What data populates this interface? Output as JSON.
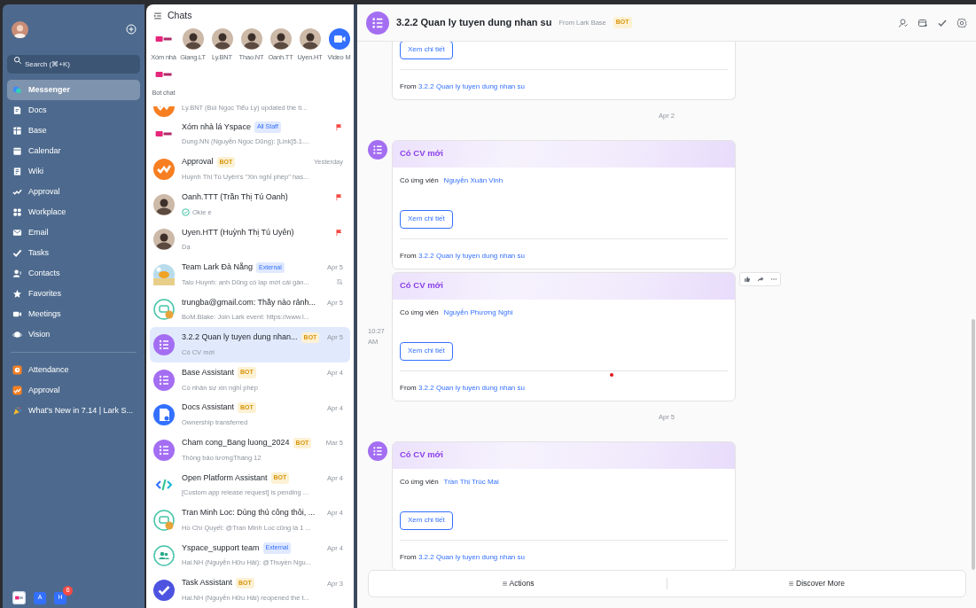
{
  "sidebar": {
    "search": {
      "placeholder": "Search (⌘+K)"
    },
    "items": [
      {
        "label": "Messenger",
        "selected": true
      },
      {
        "label": "Docs",
        "selected": false
      },
      {
        "label": "Base",
        "selected": false
      },
      {
        "label": "Calendar",
        "selected": false
      },
      {
        "label": "Wiki",
        "selected": false
      },
      {
        "label": "Approval",
        "selected": false
      },
      {
        "label": "Workplace",
        "selected": false
      },
      {
        "label": "Email",
        "selected": false
      },
      {
        "label": "Tasks",
        "selected": false
      },
      {
        "label": "Contacts",
        "selected": false
      },
      {
        "label": "Favorites",
        "selected": false
      },
      {
        "label": "Meetings",
        "selected": false
      },
      {
        "label": "Vision",
        "selected": false
      }
    ],
    "pinned": [
      {
        "label": "Attendance"
      },
      {
        "label": "Approval"
      },
      {
        "label": "What's New in 7.14 | Lark S..."
      }
    ],
    "dock": [
      {
        "kind": "logo"
      },
      {
        "kind": "letter",
        "label": "A"
      },
      {
        "kind": "letter",
        "label": "H",
        "badge": "6"
      }
    ]
  },
  "chats": {
    "title": "Chats",
    "pinned": [
      {
        "label": "Xóm nhà",
        "kind": "logo"
      },
      {
        "label": "Giang.LT",
        "kind": "person"
      },
      {
        "label": "Ly.BNT",
        "kind": "person"
      },
      {
        "label": "Thao.NT",
        "kind": "person"
      },
      {
        "label": "Oanh.TT",
        "kind": "person"
      },
      {
        "label": "Uyen.HT",
        "kind": "person"
      },
      {
        "label": "Video M",
        "kind": "video"
      },
      {
        "label": "Bot chat",
        "kind": "logo"
      }
    ],
    "items": [
      {
        "kind": "approval",
        "preview": "Ly.BNT (Bùi Ngọc Tiểu Ly) updated the ti...",
        "selected": false,
        "flagged": false,
        "muted": false,
        "read": false
      },
      {
        "kind": "logo",
        "name": "Xóm nhà lá Yspace",
        "tag": {
          "label": "All Staff",
          "kind": "team"
        },
        "preview": "Dung.NN (Nguyễn Ngọc Dũng): [Link]5.1....",
        "selected": false,
        "flagged": true,
        "muted": false,
        "read": false
      },
      {
        "kind": "approval",
        "name": "Approval",
        "tag": {
          "label": "BOT",
          "kind": "bot"
        },
        "date": "Yesterday",
        "preview": "Huỳnh Thị Tú Uyên's \"Xin nghỉ phép\" has...",
        "selected": false,
        "flagged": false,
        "muted": false,
        "read": false
      },
      {
        "kind": "person",
        "name": "Oanh.TTT (Trần Thị Tú Oanh)",
        "preview": "Okie e",
        "selected": false,
        "flagged": true,
        "muted": false,
        "read": true
      },
      {
        "kind": "person",
        "name": "Uyen.HTT (Huỳnh Thị Tú Uyên)",
        "preview": "Dạ",
        "selected": false,
        "flagged": true,
        "muted": false,
        "read": false
      },
      {
        "name": "Team Lark Đà Nẵng",
        "tag": {
          "label": "External",
          "kind": "team"
        },
        "date": "Apr 5",
        "preview": "Talo Huynh: anh Dũng có lap mới cái gàn...",
        "selected": false,
        "flagged": false,
        "muted": true,
        "read": false
      },
      {
        "kind": "chat",
        "name": "trungba@gmail.com: Thầy nào rảnh...",
        "date": "Apr 5",
        "preview": "BoM.Blake: Join Lark event: https://www.l...",
        "selected": false,
        "flagged": false,
        "muted": false,
        "read": false
      },
      {
        "kind": "list",
        "name": "3.2.2 Quan ly tuyen dung nhan...",
        "tag": {
          "label": "BOT",
          "kind": "bot"
        },
        "date": "Apr 5",
        "preview": "Có CV mới",
        "selected": true,
        "flagged": false,
        "muted": false,
        "read": false
      },
      {
        "kind": "list",
        "name": "Base Assistant",
        "tag": {
          "label": "BOT",
          "kind": "bot"
        },
        "date": "Apr 4",
        "preview": "Có nhân sự xin nghỉ phép",
        "selected": false,
        "flagged": false,
        "muted": false,
        "read": false
      },
      {
        "kind": "docs",
        "name": "Docs Assistant",
        "tag": {
          "label": "BOT",
          "kind": "bot"
        },
        "date": "Apr 4",
        "preview": "Ownership transferred",
        "selected": false,
        "flagged": false,
        "muted": false,
        "read": false
      },
      {
        "kind": "list",
        "name": "Cham cong_Bang luong_2024",
        "tag": {
          "label": "BOT",
          "kind": "bot"
        },
        "date": "Mar 5",
        "preview": "Thông báo lươngTháng 12",
        "selected": false,
        "flagged": false,
        "muted": false,
        "read": false
      },
      {
        "kind": "code",
        "name": "Open Platform Assistant",
        "tag": {
          "label": "BOT",
          "kind": "bot"
        },
        "date": "Apr 4",
        "preview": "[Custom app release request] is pending ...",
        "selected": false,
        "flagged": false,
        "muted": false,
        "read": false
      },
      {
        "kind": "chat",
        "name": "Tran Minh Loc: Dùng thủ công thôi, ...",
        "date": "Apr 4",
        "preview": "Hồ Chí Quyết: @Tran Minh Loc cũng là 1 ...",
        "selected": false,
        "flagged": false,
        "muted": false,
        "read": false
      },
      {
        "kind": "group",
        "name": "Yspace_support team",
        "tag": {
          "label": "External",
          "kind": "team"
        },
        "date": "Apr 4",
        "preview": "Hai.NH (Nguyễn Hữu Hải): @Thuyền Ngu...",
        "selected": false,
        "flagged": false,
        "muted": false,
        "read": false
      },
      {
        "kind": "task",
        "name": "Task Assistant",
        "tag": {
          "label": "BOT",
          "kind": "bot"
        },
        "date": "Apr 3",
        "preview": "Hai.NH (Nguyễn Hữu Hải) reopened the t...",
        "selected": false,
        "flagged": false,
        "muted": false,
        "read": false
      }
    ]
  },
  "conversation": {
    "title": "3.2.2 Quan ly tuyen dung nhan su",
    "subtitle": "From Lark Base",
    "tag": "BOT",
    "messages": [
      {
        "kind": "card",
        "button": "Xem chi tiết",
        "from_label": "From",
        "from_link": "3.2.2 Quan ly tuyen dung nhan su",
        "avatar": false,
        "toolbar": false
      },
      {
        "kind": "date",
        "text": "Apr 2"
      },
      {
        "kind": "card",
        "heading": "Có CV mới",
        "field_label": "Có ứng viên",
        "field_value": "Nguyễn Xuân Vinh",
        "button": "Xem chi tiết",
        "from_label": "From",
        "from_link": "3.2.2 Quan ly tuyen dung nhan su",
        "avatar": true,
        "toolbar": false
      },
      {
        "kind": "card",
        "heading": "Có CV mới",
        "field_label": "Có ứng viên",
        "field_value": "Nguyễn Phương Nghi",
        "button": "Xem chi tiết",
        "from_label": "From",
        "from_link": "3.2.2 Quan ly tuyen dung nhan su",
        "avatar": false,
        "time": "10:27 AM",
        "toolbar": true
      },
      {
        "kind": "date",
        "text": "Apr 5"
      },
      {
        "kind": "card",
        "heading": "Có CV mới",
        "field_label": "Có ứng viên",
        "field_value": "Trần Thị Trúc Mai",
        "button": "Xem chi tiết",
        "from_label": "From",
        "from_link": "3.2.2 Quan ly tuyen dung nhan su",
        "avatar": true,
        "toolbar": false
      }
    ],
    "footer": [
      "Actions",
      "Discover More"
    ]
  }
}
